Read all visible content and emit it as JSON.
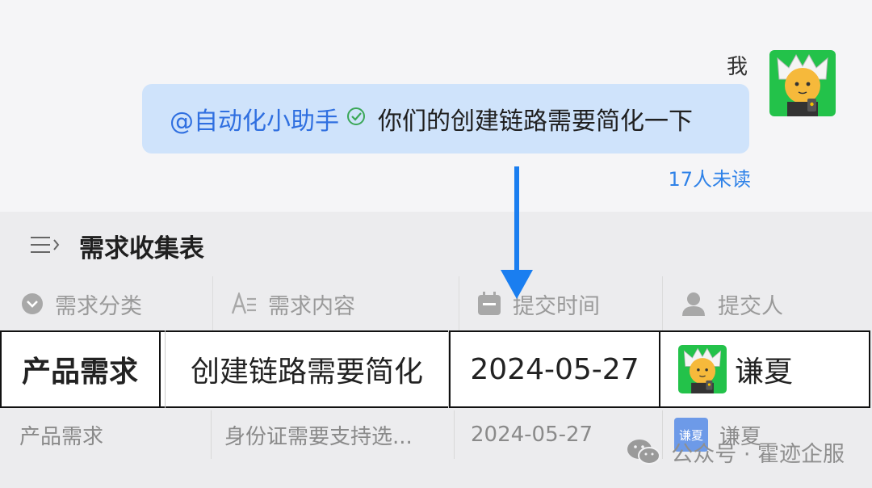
{
  "chat": {
    "sender": "我",
    "mention": "@自动化小助手",
    "message": "你们的创建链路需要简化一下",
    "unread": "17人未读"
  },
  "sheet": {
    "title": "需求收集表",
    "columns": [
      {
        "label": "需求分类",
        "icon": "chevron-circle-icon"
      },
      {
        "label": "需求内容",
        "icon": "text-format-icon"
      },
      {
        "label": "提交时间",
        "icon": "calendar-icon"
      },
      {
        "label": "提交人",
        "icon": "person-icon"
      }
    ],
    "rows": [
      {
        "category": "产品需求",
        "content": "创建链路需要简化",
        "date": "2024-05-27",
        "submitter": "谦夏"
      },
      {
        "category": "产品需求",
        "content": "身份证需要支持选...",
        "date": "2024-05-27",
        "submitter": "谦夏",
        "badge": "谦夏"
      }
    ]
  },
  "watermark": "公众号 · 霍迹企服",
  "colors": {
    "bubble": "#cfe3fb",
    "link": "#2f82e8",
    "arrow": "#1a7ef0",
    "avatar_bg": "#23c24a"
  }
}
